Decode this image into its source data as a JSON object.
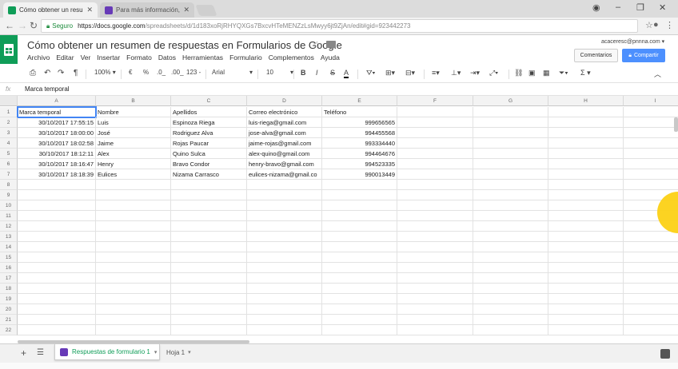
{
  "browser": {
    "tabs": [
      {
        "title": "Cómo obtener un resumen",
        "active": true
      },
      {
        "title": "Para más información, m",
        "active": false
      }
    ],
    "url_secure_label": "Seguro",
    "url_domain": "https://docs.google.com",
    "url_path": "/spreadsheets/d/1d183xoRjRHYQXGs7BxcvHTeMENZzLsMwyy6jt9ZjAn/edit#gid=923442273"
  },
  "sheet": {
    "title": "Cómo obtener un resumen de respuestas en Formularios de Google",
    "menu": [
      "Archivo",
      "Editar",
      "Ver",
      "Insertar",
      "Formato",
      "Datos",
      "Herramientas",
      "Formulario",
      "Complementos",
      "Ayuda"
    ],
    "account": "acaceresc@pnnna.com",
    "comments_label": "Comentarios",
    "share_label": "Compartir",
    "toolbar": {
      "zoom": "100%",
      "currency": "€",
      "percent": "%",
      "dec_less": ".0_",
      "dec_more": ".00_",
      "format_more": "123 -",
      "font": "Arial",
      "size": "10",
      "bold": "B",
      "italic": "I",
      "strike": "S",
      "textcolor": "A",
      "functions": "Σ"
    },
    "formula_bar": {
      "fx": "fx",
      "value": "Marca temporal"
    },
    "columns": [
      "A",
      "B",
      "C",
      "D",
      "E",
      "F",
      "G",
      "H",
      "I"
    ],
    "row_numbers": [
      "1",
      "2",
      "3",
      "4",
      "5",
      "6",
      "7",
      "8",
      "9",
      "10",
      "11",
      "12",
      "13",
      "14",
      "15",
      "16",
      "17",
      "18",
      "19",
      "20",
      "21",
      "22"
    ],
    "headers": [
      "Marca temporal",
      "Nombre",
      "Apellidos",
      "Correo electrónico",
      "Teléfono"
    ],
    "rows": [
      [
        "30/10/2017 17:55:15",
        "Luis",
        "Espinoza Riega",
        "luis-riega@gmail.com",
        "999656565"
      ],
      [
        "30/10/2017 18:00:00",
        "José",
        "Rodriguez Alva",
        "jose-alva@gmail.com",
        "994455568"
      ],
      [
        "30/10/2017 18:02:58",
        "Jaime",
        "Rojas Paucar",
        "jaime-rojas@gmail.com",
        "993334440"
      ],
      [
        "30/10/2017 18:12:11",
        "Alex",
        "Quino Sulca",
        "alex-quino@gmail.com",
        "994464676"
      ],
      [
        "30/10/2017 18:16:47",
        "Henry",
        "Bravo Condor",
        "henry-bravo@gmail.com",
        "994523335"
      ],
      [
        "30/10/2017 18:18:39",
        "Eulices",
        "Nizama Carrasco",
        "eulices-nizama@gmail.co",
        "990013449"
      ]
    ],
    "sheet_tabs": [
      "Respuestas de formulario 1",
      "Hoja 1"
    ]
  },
  "colors": {
    "sheets_green": "#0f9d58",
    "share_blue": "#4d90fe",
    "selection": "#4285f4",
    "cursor_highlight": "#fcd116"
  }
}
